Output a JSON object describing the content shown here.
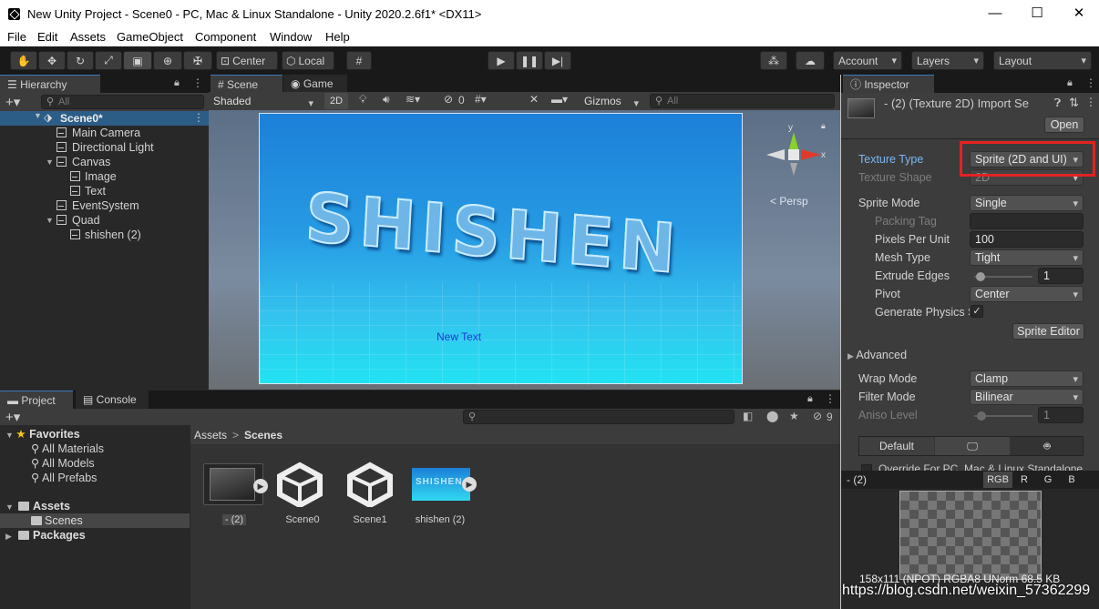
{
  "window": {
    "title": "New Unity Project - Scene0 - PC, Mac & Linux Standalone - Unity 2020.2.6f1* <DX11>",
    "minimize": "—",
    "maximize": "☐",
    "close": "✕"
  },
  "menu": [
    "File",
    "Edit",
    "Assets",
    "GameObject",
    "Component",
    "Window",
    "Help"
  ],
  "toolbar": {
    "center": "Center",
    "local": "Local",
    "account": "Account",
    "layers": "Layers",
    "layout": "Layout"
  },
  "hierarchy": {
    "tab": "Hierarchy",
    "search_placeholder": "All",
    "scene": "Scene0*",
    "items": [
      "Main Camera",
      "Directional Light",
      "Canvas",
      "Image",
      "Text",
      "EventSystem",
      "Quad",
      "shishen (2)"
    ]
  },
  "scene": {
    "tab_scene": "Scene",
    "tab_game": "Game",
    "shading": "Shaded",
    "mode_2d": "2D",
    "hidden_count": "0",
    "gizmos": "Gizmos",
    "search_placeholder": "All",
    "sprite_text": "SHISHEN",
    "new_text": "New Text",
    "persp": "< Persp",
    "axis_y": "y",
    "axis_x": "x"
  },
  "project": {
    "tab_project": "Project",
    "tab_console": "Console",
    "hidden_count": "9",
    "favorites": "Favorites",
    "fav_items": [
      "All Materials",
      "All Models",
      "All Prefabs"
    ],
    "assets": "Assets",
    "scenes": "Scenes",
    "packages": "Packages",
    "breadcrumb_root": "Assets",
    "breadcrumb_sep": ">",
    "breadcrumb_leaf": "Scenes",
    "files": [
      "- (2)",
      "Scene0",
      "Scene1",
      "shishen (2)"
    ],
    "thumb_text": "SHISHEN"
  },
  "inspector": {
    "tab": "Inspector",
    "header": "- (2) (Texture 2D) Import Se",
    "open_button": "Open",
    "texture_type_label": "Texture Type",
    "texture_type_value": "Sprite (2D and UI)",
    "texture_shape_label": "Texture Shape",
    "texture_shape_value": "2D",
    "sprite_mode_label": "Sprite Mode",
    "sprite_mode_value": "Single",
    "packing_tag_label": "Packing Tag",
    "packing_tag_value": "",
    "ppu_label": "Pixels Per Unit",
    "ppu_value": "100",
    "mesh_type_label": "Mesh Type",
    "mesh_type_value": "Tight",
    "extrude_label": "Extrude Edges",
    "extrude_value": "1",
    "extrude_level": 0.04,
    "pivot_label": "Pivot",
    "pivot_value": "Center",
    "physics_label": "Generate Physics S",
    "physics_checked": "✓",
    "sprite_editor_button": "Sprite Editor",
    "advanced": "Advanced",
    "wrap_label": "Wrap Mode",
    "wrap_value": "Clamp",
    "filter_label": "Filter Mode",
    "filter_value": "Bilinear",
    "aniso_label": "Aniso Level",
    "aniso_value": "1",
    "aniso_level": 0.06,
    "platform_default": "Default",
    "override_text": "Override For PC, Mac & Linux Standalone",
    "preview_name": "- (2)",
    "channels": [
      "RGB",
      "R",
      "G",
      "B"
    ],
    "preview_info": "158x111 (NPOT)  RGBA8 UNorm  68.5 KB"
  },
  "watermark": "https://blog.csdn.net/weixin_57362299",
  "colors": {
    "highlight_box": "#e52222",
    "selected_tab_accent": "#3a79bb",
    "blue_label": "#7cb7f2"
  }
}
